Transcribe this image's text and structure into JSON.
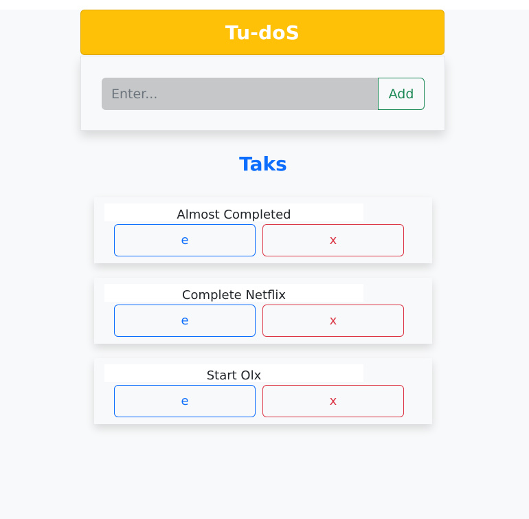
{
  "app": {
    "title": "Tu-doS"
  },
  "form": {
    "placeholder": "Enter...",
    "value": "",
    "add_label": "Add"
  },
  "list": {
    "title": "Taks",
    "tasks": [
      {
        "name": "Almost Completed",
        "edit_label": "e",
        "delete_label": "x"
      },
      {
        "name": "Complete Netflix",
        "edit_label": "e",
        "delete_label": "x"
      },
      {
        "name": "Start Olx",
        "edit_label": "e",
        "delete_label": "x"
      }
    ]
  },
  "colors": {
    "header_bg": "#ffc107",
    "primary": "#0d6efd",
    "success": "#198754",
    "danger": "#dc3545",
    "page_bg": "#f8f9fa"
  }
}
